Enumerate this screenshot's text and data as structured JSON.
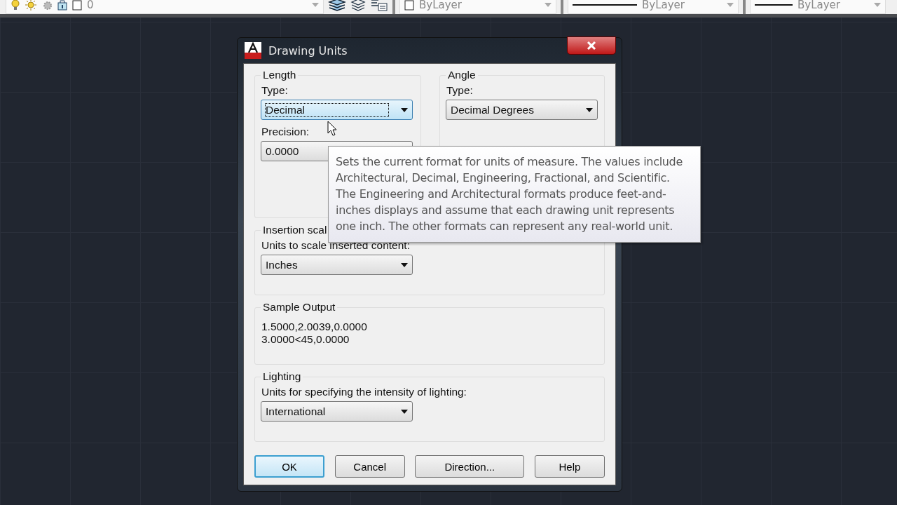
{
  "toolbar": {
    "layer_name": "0",
    "color_setting": "ByLayer",
    "linetype": "ByLayer",
    "lineweight": "ByLayer"
  },
  "dialog": {
    "title": "Drawing Units",
    "length": {
      "title": "Length",
      "type_label": "Type:",
      "type": {
        "value": "Decimal",
        "focused": true
      },
      "precision_label": "Precision:",
      "precision": "0.0000"
    },
    "angle": {
      "title": "Angle",
      "type_label": "Type:",
      "type": {
        "value": "Decimal Degrees",
        "focused": false
      }
    },
    "insertion": {
      "title": "Insertion scal",
      "label": "Units to scale inserted content:",
      "value": "Inches"
    },
    "sample": {
      "title": "Sample Output",
      "lines": [
        "1.5000,2.0039,0.0000",
        "3.0000<45,0.0000"
      ]
    },
    "lighting": {
      "title": "Lighting",
      "label": "Units for specifying the intensity of lighting:",
      "value": "International"
    },
    "buttons": [
      {
        "label": "OK",
        "default": true
      },
      {
        "label": "Cancel",
        "default": false
      },
      {
        "label": "Direction...",
        "default": false
      },
      {
        "label": "Help",
        "default": false
      }
    ]
  },
  "tooltip": {
    "lines": [
      "Sets the current format for units of measure. The values include",
      "Architectural, Decimal, Engineering, Fractional, and Scientific.",
      "The Engineering and Architectural formats produce feet-and-",
      "inches displays and assume that each drawing unit represents",
      "one inch. The other formats can represent any real-world unit."
    ]
  }
}
